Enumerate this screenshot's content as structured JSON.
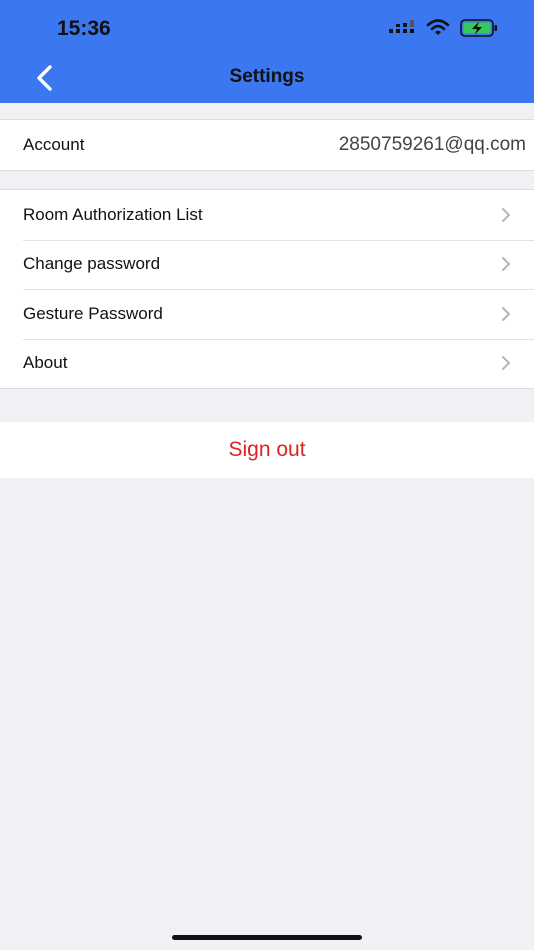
{
  "status_bar": {
    "time": "15:36"
  },
  "nav": {
    "title": "Settings"
  },
  "account": {
    "label": "Account",
    "value": "2850759261@qq.com"
  },
  "menu": {
    "items": [
      {
        "label": "Room Authorization List"
      },
      {
        "label": "Change password"
      },
      {
        "label": "Gesture Password"
      },
      {
        "label": "About"
      }
    ]
  },
  "sign_out": {
    "label": "Sign out"
  },
  "colors": {
    "header": "#3a77f1",
    "sign_out": "#e32020",
    "background": "#f0f0f5"
  },
  "icons": [
    "back-icon",
    "signal-icon",
    "wifi-icon",
    "battery-charging-icon",
    "chevron-right-icon"
  ]
}
